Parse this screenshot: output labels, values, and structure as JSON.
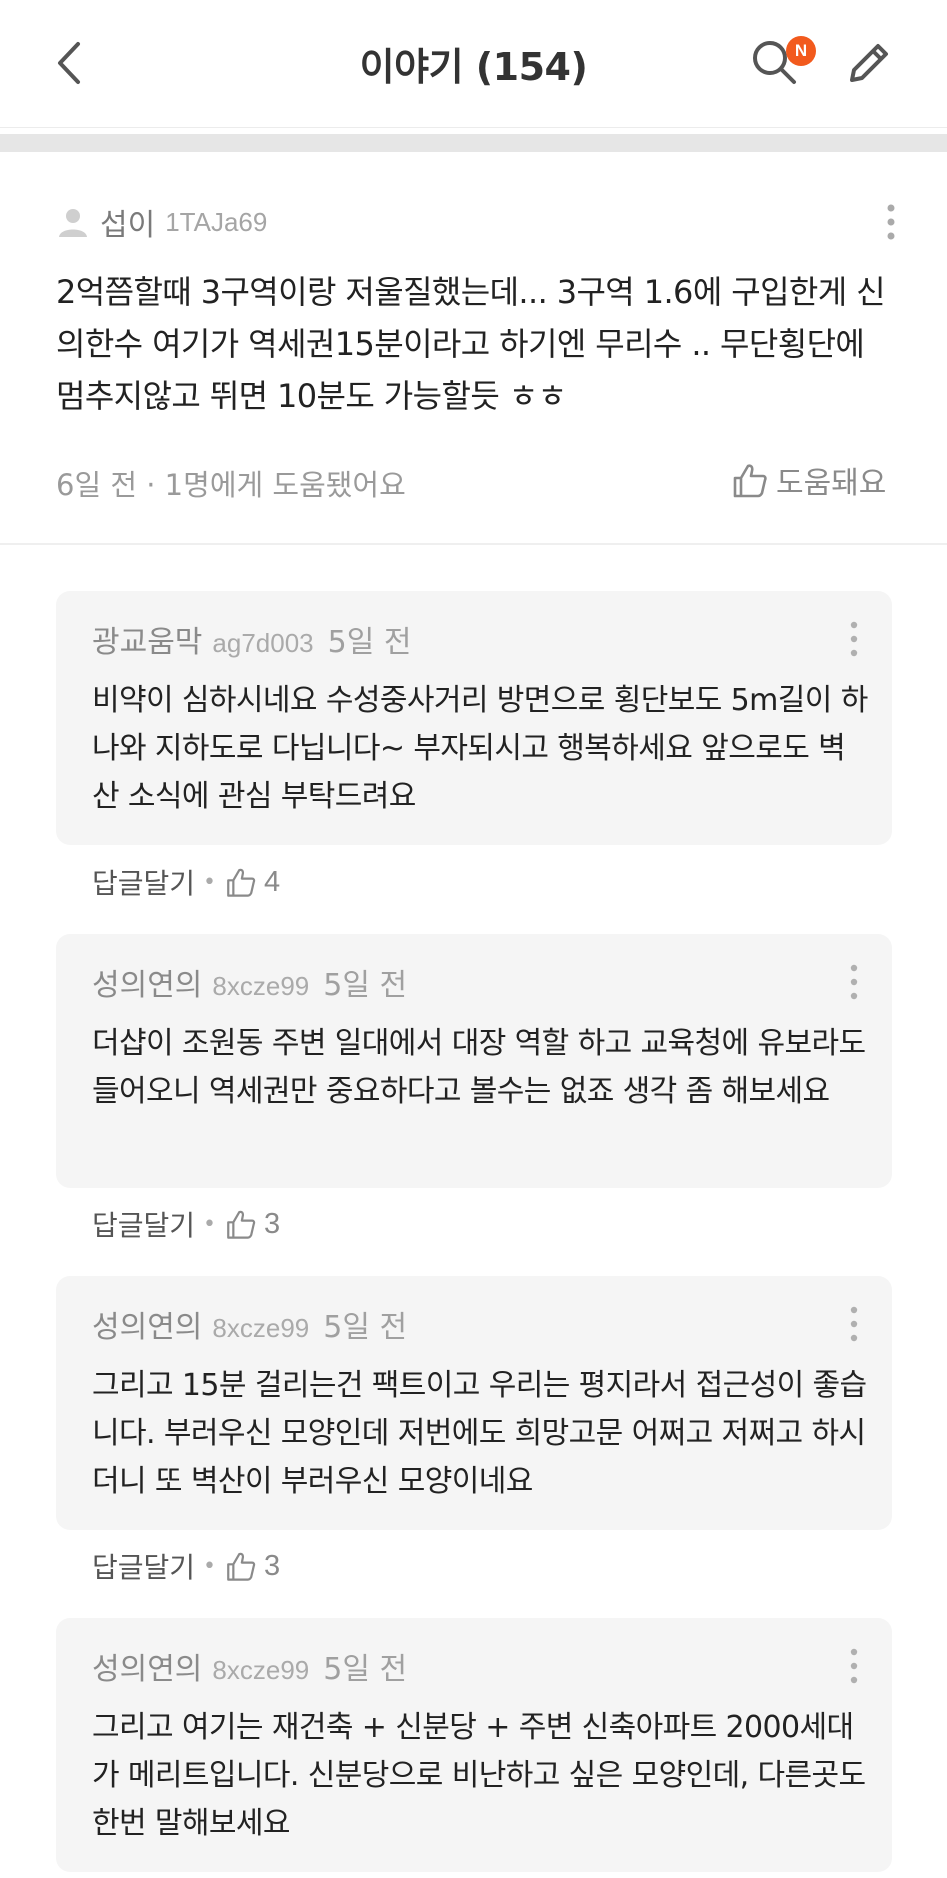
{
  "header": {
    "title": "이야기 (154)",
    "back_icon": "chevron-left-icon",
    "search_icon": "search-icon",
    "badge_text": "N",
    "badge_color": "#f25a1d",
    "write_icon": "pencil-icon"
  },
  "post": {
    "nickname": "섭이",
    "user_id": "1TAJa69",
    "body": "2억쯤할때 3구역이랑 저울질했는데... 3구역 1.6에 구입한게 신의한수 여기가 역세권15분이라고 하기엔 무리수 .. 무단횡단에 멈추지않고 뛰면 10분도 가능할듯 ㅎㅎ",
    "footer": "6일 전 · 1명에게 도움됐어요",
    "helpful_label": "도움돼요"
  },
  "comments": [
    {
      "nickname": "광교움막",
      "user_id": "ag7d003",
      "time": "5일 전",
      "text": "비약이 심하시네요 수성중사거리 방면으로 횡단보도 5m길이 하나와 지하도로 다닙니다~ 부자되시고 행복하세요 앞으로도 벽산 소식에 관심 부탁드려요",
      "reply_label": "답글달기",
      "likes": "4"
    },
    {
      "nickname": "성의연의",
      "user_id": "8xcze99",
      "time": "5일 전",
      "text": "더샵이 조원동 주변 일대에서 대장 역할 하고 교육청에 유보라도 들어오니 역세권만 중요하다고 볼수는 없죠 생각 좀 해보세요",
      "reply_label": "답글달기",
      "likes": "3"
    },
    {
      "nickname": "성의연의",
      "user_id": "8xcze99",
      "time": "5일 전",
      "text": "그리고 15분 걸리는건 팩트이고 우리는 평지라서 접근성이 좋습니다. 부러우신 모양인데 저번에도 희망고문 어쩌고 저쩌고 하시더니 또 벽산이 부러우신 모양이네요",
      "reply_label": "답글달기",
      "likes": "3"
    },
    {
      "nickname": "성의연의",
      "user_id": "8xcze99",
      "time": "5일 전",
      "text": "그리고 여기는 재건축 + 신분당 + 주변 신축아파트 2000세대 가 메리트입니다. 신분당으로 비난하고 싶은 모양인데, 다른곳도 한번 말해보세요"
    }
  ]
}
